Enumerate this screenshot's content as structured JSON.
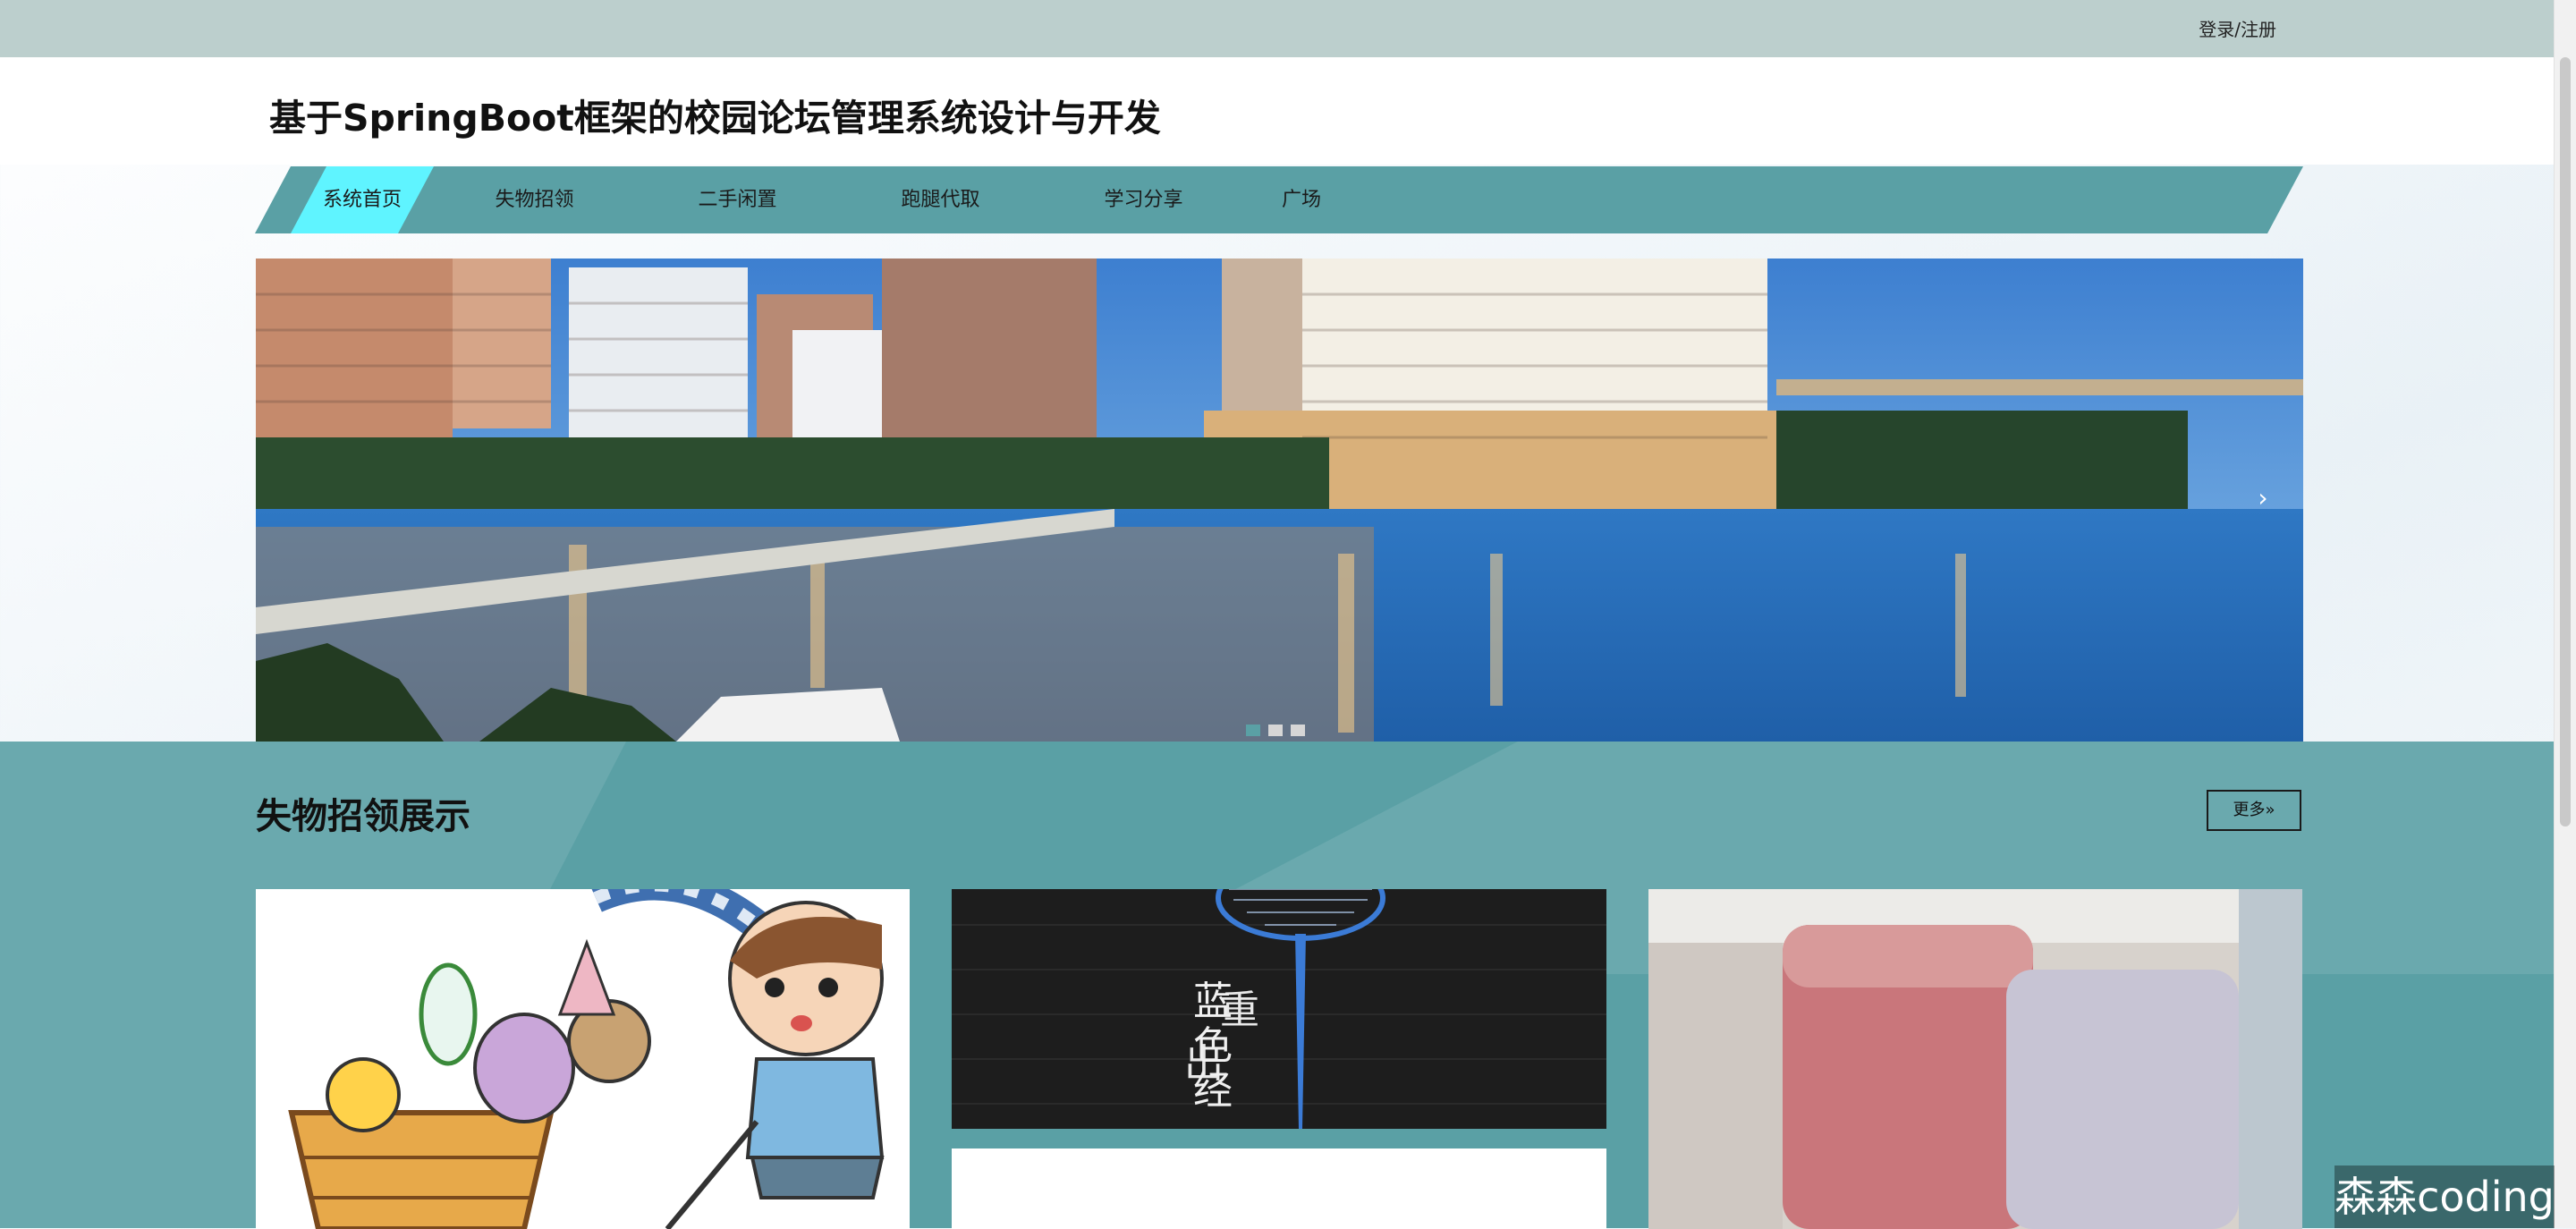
{
  "topbar": {
    "login_register": "登录/注册"
  },
  "header": {
    "site_title": "基于SpringBoot框架的校园论坛管理系统设计与开发"
  },
  "nav": {
    "items": [
      {
        "label": "系统首页",
        "active": true
      },
      {
        "label": "失物招领",
        "active": false
      },
      {
        "label": "二手闲置",
        "active": false
      },
      {
        "label": "跑腿代取",
        "active": false
      },
      {
        "label": "学习分享",
        "active": false
      },
      {
        "label": "广场",
        "active": false
      }
    ]
  },
  "carousel": {
    "slides_count": 3,
    "active_index": 0,
    "next_icon": "chevron-right-icon"
  },
  "section": {
    "title": "失物招领展示",
    "more_label": "更多»"
  },
  "cards": [
    {
      "image": "cartoon-boy-with-toy-basket"
    },
    {
      "image": "blue-badminton-racket",
      "image_text": "蓝色经典 重出"
    },
    {
      "image": "blurred-pink-tubes"
    }
  ],
  "watermark": "森森coding",
  "colors": {
    "topbar": "#bccfcd",
    "nav_teal": "#5aa0a5",
    "nav_active": "#5ff4ff",
    "section_teal": "#5aa0a5"
  }
}
